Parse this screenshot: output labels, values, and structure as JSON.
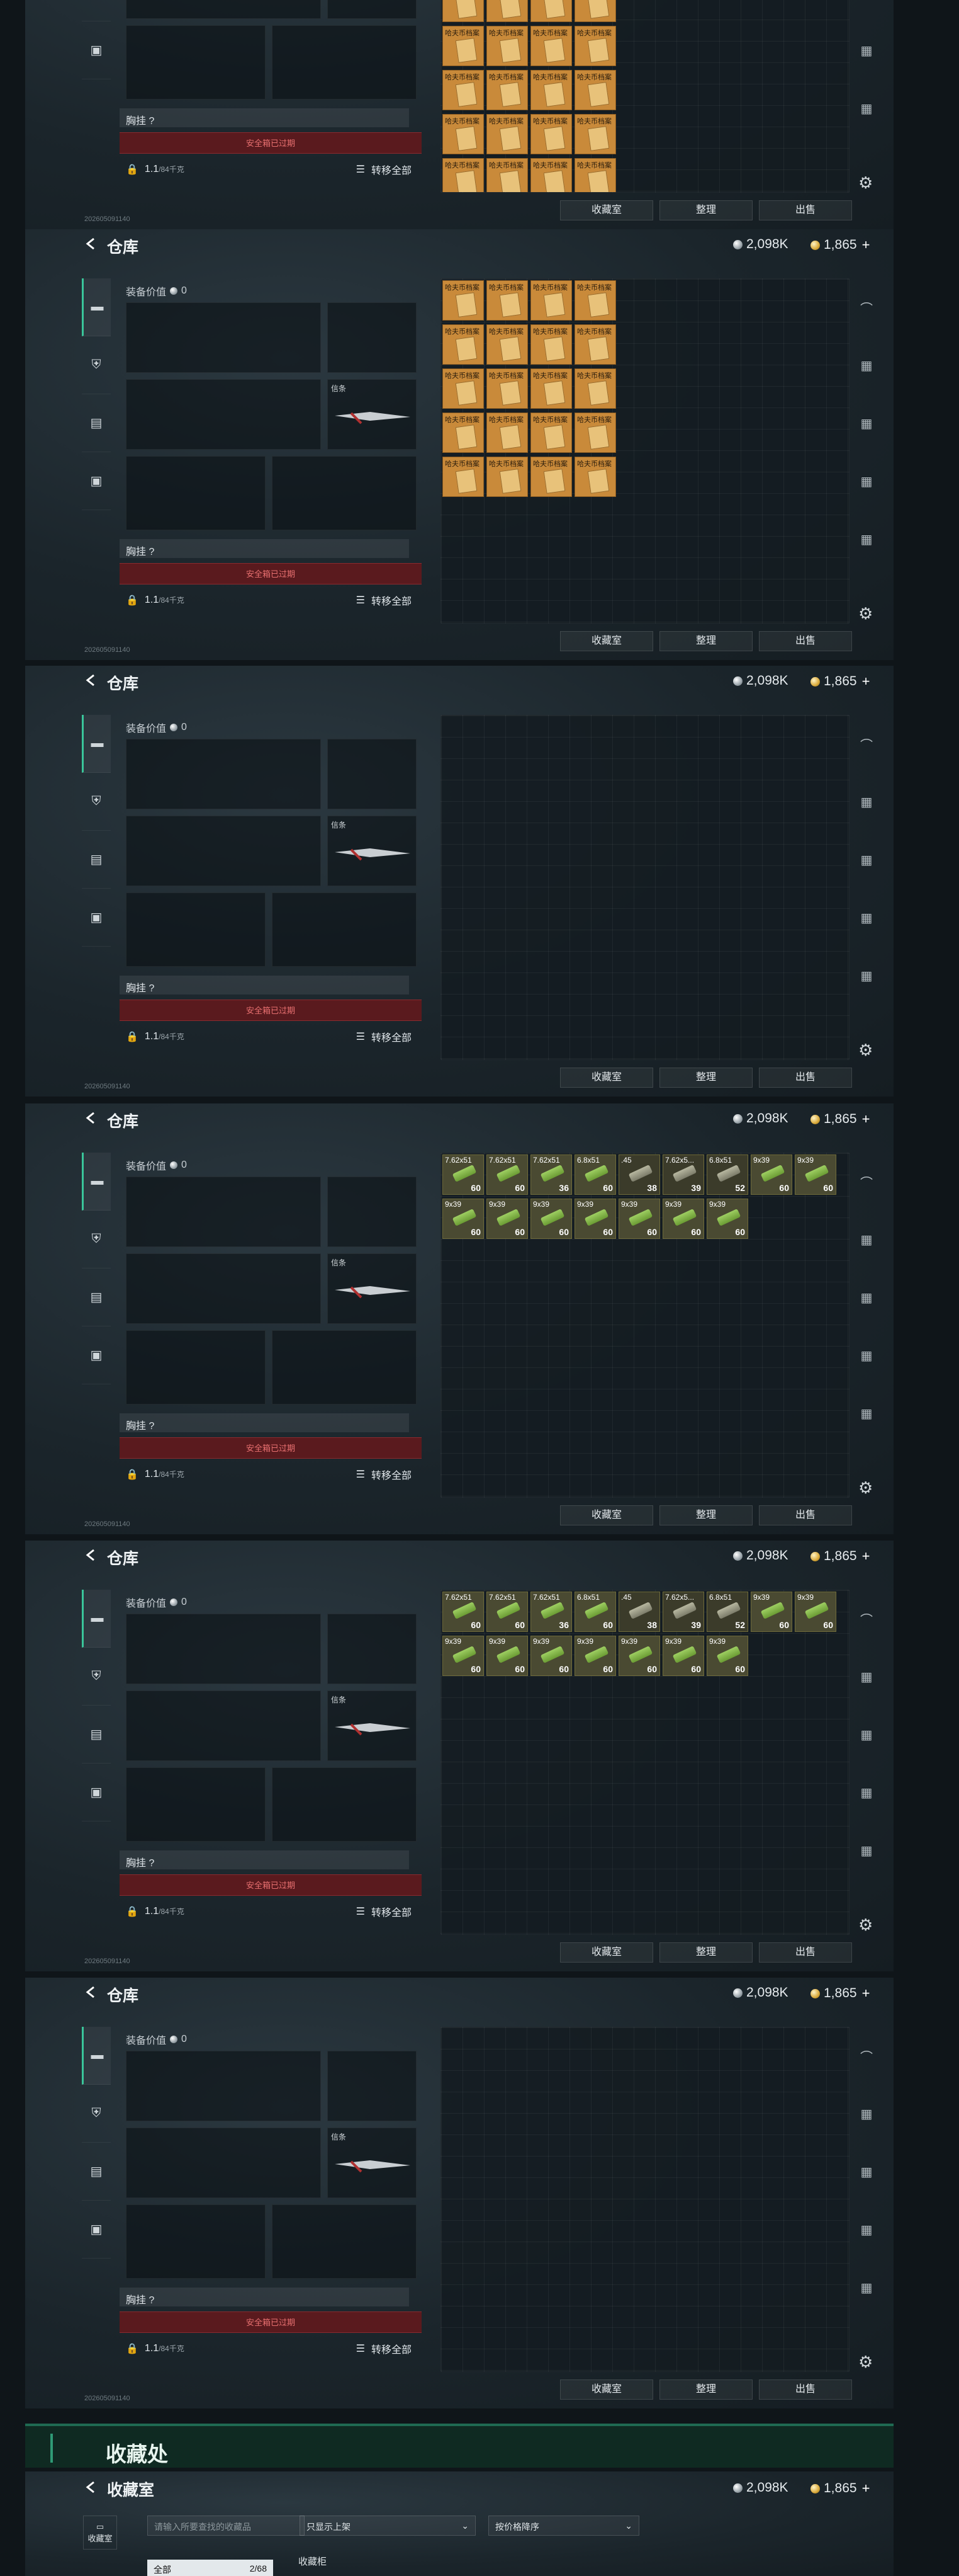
{
  "header": {
    "title": "仓库",
    "silver": "2,098K",
    "gold": "1,865",
    "plus": "+"
  },
  "left": {
    "value_label": "装备价值",
    "value": "0",
    "knife_tag": "信条",
    "chest_label": "胸挂 ?",
    "warning": "安全箱已过期",
    "weight": "1.1",
    "weight_unit": "/84千克",
    "transfer_all": "转移全部"
  },
  "actions": {
    "collection": "收藏室",
    "sort": "整理",
    "sell": "出售"
  },
  "status": "202605091140",
  "docs": {
    "name": "哈夫币档案"
  },
  "ammo_items": [
    {
      "cal": "7.62x51",
      "count": "60"
    },
    {
      "cal": "7.62x51",
      "count": "60"
    },
    {
      "cal": "7.62x51",
      "count": "36"
    },
    {
      "cal": "6.8x51",
      "count": "60"
    },
    {
      "cal": ".45",
      "count": "38"
    },
    {
      "cal": "7.62x5...",
      "count": "39"
    },
    {
      "cal": "6.8x51",
      "count": "52"
    },
    {
      "cal": "9x39",
      "count": "60"
    },
    {
      "cal": "9x39",
      "count": "60"
    },
    {
      "cal": "9x39",
      "count": "60"
    },
    {
      "cal": "9x39",
      "count": "60"
    },
    {
      "cal": "9x39",
      "count": "60"
    },
    {
      "cal": "9x39",
      "count": "60"
    },
    {
      "cal": "9x39",
      "count": "60"
    },
    {
      "cal": "9x39",
      "count": "60"
    },
    {
      "cal": "9x39",
      "count": "60"
    }
  ],
  "banner": {
    "title": "收藏处"
  },
  "collection": {
    "title": "收藏室",
    "search_placeholder": "请输入所要查找的收藏品",
    "filter": "只显示上架",
    "sort": "按价格降序",
    "side_label": "收藏室",
    "tab_all": "全部",
    "tab_count": "2/68",
    "section": "收藏柜"
  }
}
